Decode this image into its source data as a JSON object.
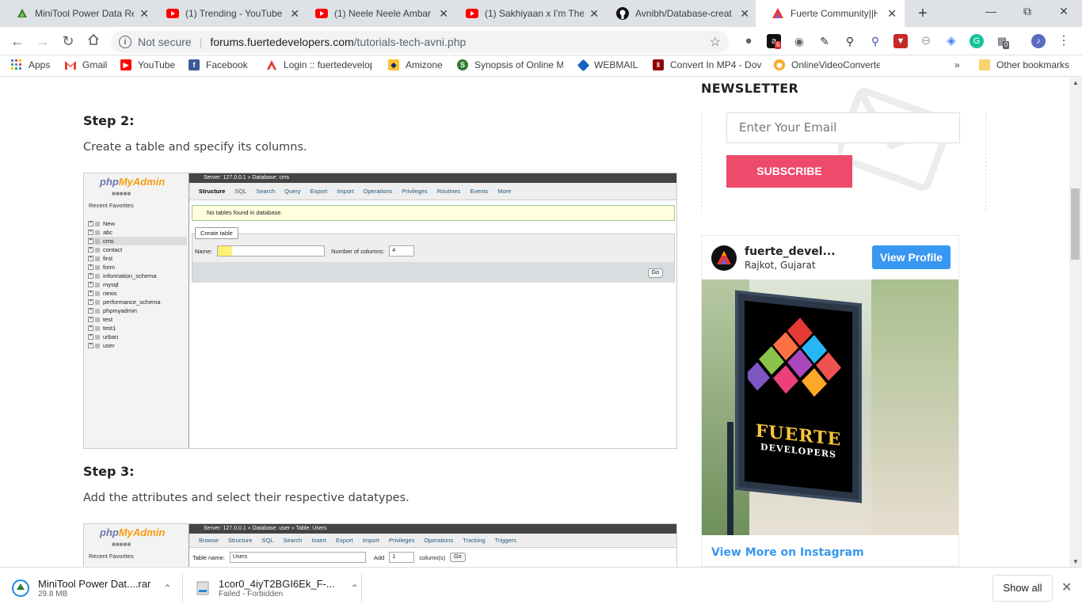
{
  "tabs": [
    {
      "title": "MiniTool Power Data Re",
      "icon": "minitool-icon",
      "color": "#2e7d32"
    },
    {
      "title": "(1) Trending - YouTube",
      "icon": "youtube-icon",
      "color": "#ff0000"
    },
    {
      "title": "(1) Neele Neele Ambar",
      "icon": "youtube-icon",
      "color": "#ff0000"
    },
    {
      "title": "(1) Sakhiyaan x I'm The",
      "icon": "youtube-icon",
      "color": "#ff0000"
    },
    {
      "title": "Avnibh/Database-creat",
      "icon": "github-icon",
      "color": "#111111"
    },
    {
      "title": "Fuerte Community||Hor",
      "icon": "fuerte-icon",
      "color": "#e53935"
    }
  ],
  "tab_close": "✕",
  "new_tab": "+",
  "omnibox": {
    "security": "Not secure",
    "host": "forums.fuertedevelopers.com",
    "path": "/tutorials-tech-avni.php"
  },
  "bookmarks": [
    {
      "label": "Apps",
      "icon": "apps-grid-icon"
    },
    {
      "label": "Gmail",
      "icon": "gmail-icon"
    },
    {
      "label": "YouTube",
      "icon": "youtube-icon"
    },
    {
      "label": "Facebook",
      "icon": "facebook-icon"
    },
    {
      "label": "Login :: fuertedevelop",
      "icon": "fuerte-icon"
    },
    {
      "label": "Amizone",
      "icon": "shield-icon"
    },
    {
      "label": "Synopsis of Online M",
      "icon": "globe-icon"
    },
    {
      "label": "WEBMAIL",
      "icon": "webmail-icon"
    },
    {
      "label": "Convert In MP4 - Dov",
      "icon": "convert-icon"
    },
    {
      "label": "OnlineVideoConverte",
      "icon": "video-converter-icon"
    }
  ],
  "bookmarks_overflow": "»",
  "other_bookmarks": "Other bookmarks",
  "extension_badges": {
    "amazon": "6",
    "ext": "0"
  },
  "content": {
    "step2_title": "Step 2:",
    "step2_text": "Create a table and specify its columns.",
    "step3_title": "Step 3:",
    "step3_text": "Add the attributes and select their respective datatypes."
  },
  "shot1": {
    "logo_php": "php",
    "logo_myadmin": "MyAdmin",
    "links": "Recent  Favorites",
    "dbs": [
      "New",
      "abc",
      "cms",
      "contact",
      "first",
      "form",
      "information_schema",
      "mysql",
      "news",
      "performance_schema",
      "phpmyadmin",
      "test",
      "test1",
      "urban",
      "user"
    ],
    "breadcrumb": "Server: 127.0.0.1 » Database: cms",
    "tabs": [
      "Structure",
      "SQL",
      "Search",
      "Query",
      "Export",
      "Import",
      "Operations",
      "Privileges",
      "Routines",
      "Events",
      "More"
    ],
    "notice": "No tables found in database.",
    "create_table": "Create table",
    "name_label": "Name:",
    "columns_label": "Number of columns:",
    "columns_value": "4",
    "go": "Go"
  },
  "shot2": {
    "logo_php": "php",
    "logo_myadmin": "MyAdmin",
    "links": "Recent  Favorites",
    "breadcrumb": "Server: 127.0.0.1 » Database: user » Table: Users",
    "tabs": [
      "Browse",
      "Structure",
      "SQL",
      "Search",
      "Insert",
      "Export",
      "Import",
      "Privileges",
      "Operations",
      "Tracking",
      "Triggers"
    ],
    "table_name_label": "Table name:",
    "table_name_value": "Users",
    "add_label": "Add",
    "add_value": "1",
    "columns_label": "column(s)",
    "go": "Go"
  },
  "sidebar": {
    "newsletter_title": "NEWSLETTER",
    "email_placeholder": "Enter Your Email",
    "subscribe": "SUBSCRIBE",
    "ig_name": "fuerte_devel...",
    "ig_location": "Rajkot, Gujarat",
    "ig_view_profile": "View Profile",
    "ig_more": "View More on Instagram",
    "poster_line1": "FUERTE",
    "poster_line2": "DEVELOPERS"
  },
  "downloads": [
    {
      "name": "MiniTool Power Dat....rar",
      "sub": "29.8 MB"
    },
    {
      "name": "1cor0_4iyT2BGI6Ek_F-...",
      "sub": "Failed - Forbidden"
    }
  ],
  "show_all": "Show all"
}
